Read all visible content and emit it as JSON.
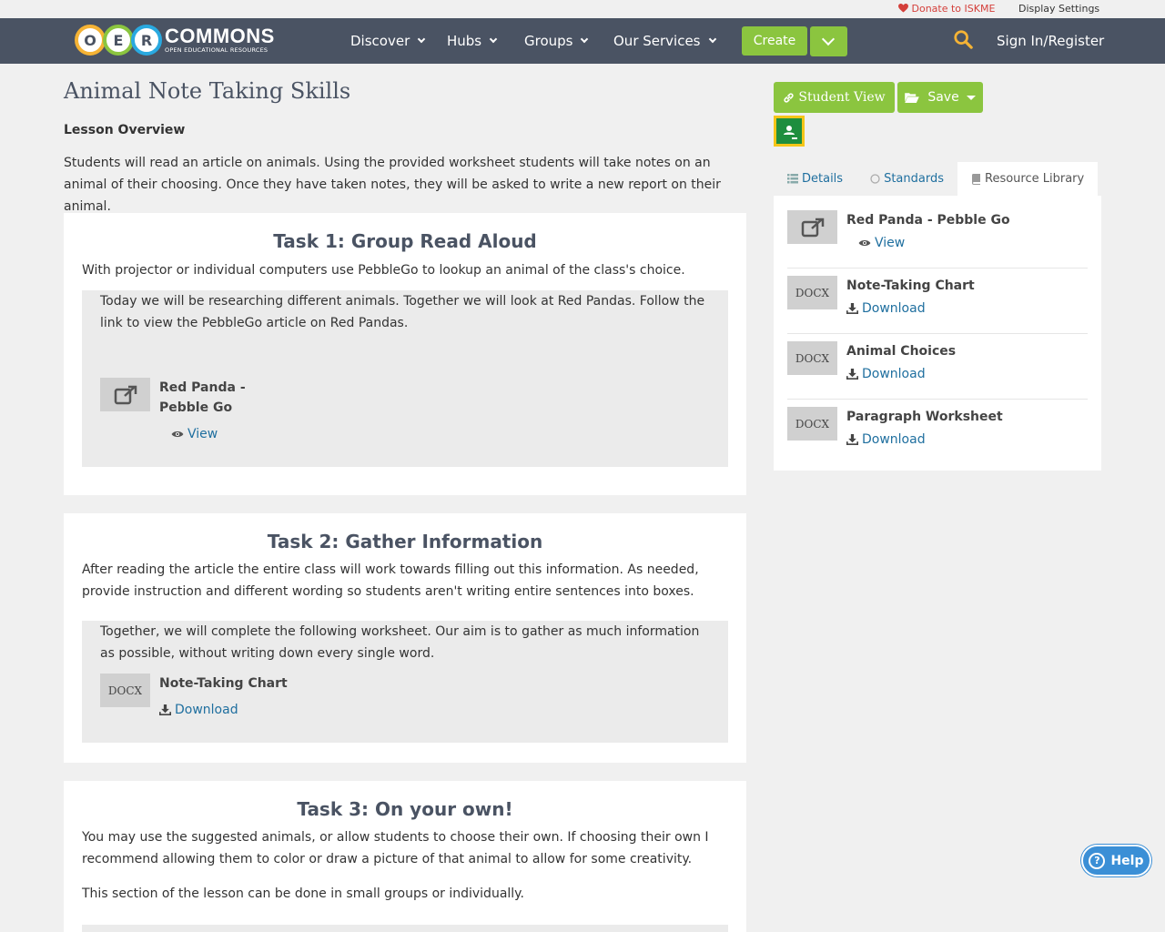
{
  "utility": {
    "donate": "Donate to ISKME",
    "display_settings": "Display Settings"
  },
  "nav": {
    "logo": {
      "letters": [
        "O",
        "E",
        "R"
      ],
      "name": "COMMONS",
      "tagline": "OPEN EDUCATIONAL RESOURCES"
    },
    "items": [
      {
        "label": "Discover"
      },
      {
        "label": "Hubs"
      },
      {
        "label": "Groups"
      },
      {
        "label": "Our Services"
      }
    ],
    "create": "Create",
    "signin": "Sign In/Register",
    "search_icon": "search-icon"
  },
  "page": {
    "title": "Animal Note Taking Skills",
    "overview_heading": "Lesson Overview",
    "overview_text": "Students will read an article on animals. Using the provided worksheet students will take notes on an animal of their choosing. Once they have taken notes, they will be asked to write a new report on their animal."
  },
  "tasks": [
    {
      "title": "Task 1: Group Read Aloud",
      "intro": "With projector or individual computers use PebbleGo to lookup an animal of the class's choice.",
      "inset_text": "Today we will be researching different animals. Together we will look at Red Pandas. Follow the link to view the PebbleGo article on Red Pandas.",
      "resource": {
        "name": "Red Panda - Pebble Go",
        "action": "View",
        "thumb_icon": "external-link-icon"
      }
    },
    {
      "title": "Task 2: Gather Information",
      "intro": "After reading the article the entire class will work towards filling out this information. As needed, provide instruction and different wording so students aren't writing entire sentences into boxes.",
      "inset_text": "Together, we will complete the following worksheet. Our aim is to gather as much information as possible, without writing down every single word.",
      "resource": {
        "name": "Note-Taking Chart",
        "action": "Download",
        "thumb": "DOCX"
      }
    },
    {
      "title": "Task 3: On your own!",
      "intro": "You may use the suggested animals, or allow students to choose their own. If choosing their own I recommend allowing them to color or draw a picture of that animal to allow for some creativity.",
      "intro2": "This section of the lesson can be done in small groups or individually."
    }
  ],
  "sidebar": {
    "student_view": "Student View",
    "save": "Save",
    "tabs": [
      {
        "label": "Details",
        "icon": "list-icon"
      },
      {
        "label": "Standards",
        "icon": "circle-icon"
      },
      {
        "label": "Resource Library",
        "icon": "book-icon",
        "active": true
      }
    ],
    "resources": [
      {
        "name": "Red Panda - Pebble Go",
        "action": "View",
        "thumb_icon": "external-link-icon"
      },
      {
        "name": "Note-Taking Chart",
        "action": "Download",
        "thumb": "DOCX"
      },
      {
        "name": "Animal Choices",
        "action": "Download",
        "thumb": "DOCX"
      },
      {
        "name": "Paragraph Worksheet",
        "action": "Download",
        "thumb": "DOCX"
      }
    ]
  },
  "help": "Help",
  "colors": {
    "nav_bg": "#4a5363",
    "accent_green": "#8bc53f",
    "link": "#1f6f9f",
    "donate_red": "#d43f3a",
    "help_blue": "#3b8fd6"
  }
}
